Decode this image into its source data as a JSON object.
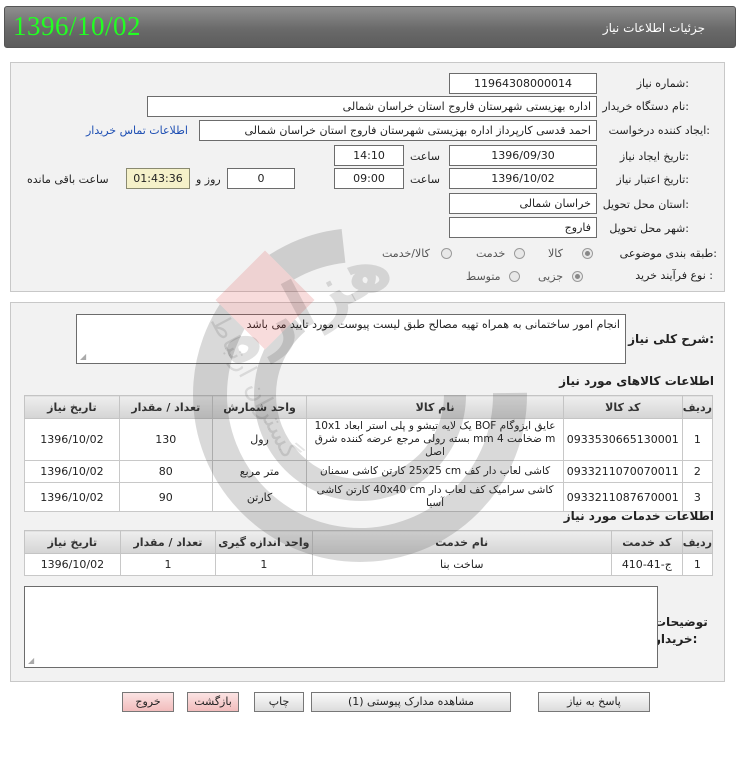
{
  "header": {
    "title": "جزئیات اطلاعات نیاز",
    "date": "1396/10/02"
  },
  "form": {
    "need_number": {
      "label": "شماره نیاز:",
      "value": "11964308000014"
    },
    "buyer_org": {
      "label": "نام دستگاه خریدار:",
      "value": "اداره بهزیستی شهرستان فاروج استان خراسان شمالی"
    },
    "requester": {
      "label": "ایجاد کننده درخواست:",
      "value": "احمد  قدسی کارپرداز اداره بهزیستی شهرستان فاروج استان خراسان شمالی",
      "contact_link": "اطلاعات تماس خریدار"
    },
    "created": {
      "label": "تاریخ ایجاد نیاز:",
      "date": "1396/09/30",
      "time_label": "ساعت",
      "time": "14:10"
    },
    "validity": {
      "label": "تاریخ اعتبار نیاز:",
      "date": "1396/10/02",
      "time_label": "ساعت",
      "time": "09:00",
      "days": "0",
      "days_label": "روز و",
      "remaining": "01:43:36",
      "remaining_label": "ساعت باقی مانده"
    },
    "province": {
      "label": "استان محل تحویل:",
      "value": "خراسان شمالی"
    },
    "city": {
      "label": "شهر محل تحویل:",
      "value": "فاروج"
    },
    "category": {
      "label": "طبقه بندی موضوعی:",
      "options": [
        "کالا",
        "خدمت",
        "کالا/خدمت"
      ],
      "selected": "کالا"
    },
    "purchase_type": {
      "label": "نوع فرآیند خرید :",
      "options": [
        "جزیی",
        "متوسط"
      ],
      "selected": "جزیی"
    }
  },
  "description": {
    "label": "شرح کلی نیاز:",
    "text": "انجام امور ساختمانی به همراه تهیه مصالح طبق لیست پیوست مورد تایید می باشد"
  },
  "goods": {
    "title": "اطلاعات کالاهای مورد نیاز",
    "headers": [
      "ردیف",
      "کد کالا",
      "نام کالا",
      "واحد شمارش",
      "تعداد / مقدار",
      "تاریخ نیاز"
    ],
    "rows": [
      [
        "1",
        "0933530665130001",
        "عایق ایزوگام BOF یک لایه تیشو و پلی استر ابعاد 10x1 m ضخامت 4 mm بسته رولی مرجع عرضه کننده شرق اصل",
        "رول",
        "130",
        "1396/10/02"
      ],
      [
        "2",
        "0933211070070011",
        "کاشی لعاب دار کف 25x25 cm کارتن کاشی سمنان",
        "متر مربع",
        "80",
        "1396/10/02"
      ],
      [
        "3",
        "0933211087670001",
        "کاشی سرامیک کف لعاب دار 40x40 cm کارتن کاشی آسیا",
        "کارتن",
        "90",
        "1396/10/02"
      ]
    ]
  },
  "services": {
    "title": "اطلاعات خدمات مورد نیاز",
    "headers": [
      "ردیف",
      "کد خدمت",
      "نام خدمت",
      "واحد اندازه گیری",
      "تعداد / مقدار",
      "تاریخ نیاز"
    ],
    "rows": [
      [
        "1",
        "ج-41-410",
        "ساخت بنا",
        "1",
        "1",
        "1396/10/02"
      ]
    ]
  },
  "comments": {
    "label": "توضیحات خریدار:",
    "value": ""
  },
  "buttons": {
    "reply": "پاسخ به نیاز",
    "attachments": "مشاهده مدارک پیوستی (1)",
    "print": "چاپ",
    "back": "بازگشت",
    "exit": "خروج"
  },
  "watermark": {
    "text": "هزاره",
    "subtext": "گستران ارتباط"
  },
  "colors": {
    "date_green": "#22ff22",
    "link_blue": "#1e4fb3",
    "header_gray": "#6a6a6a",
    "remaining_bg": "#f5f1c9"
  }
}
